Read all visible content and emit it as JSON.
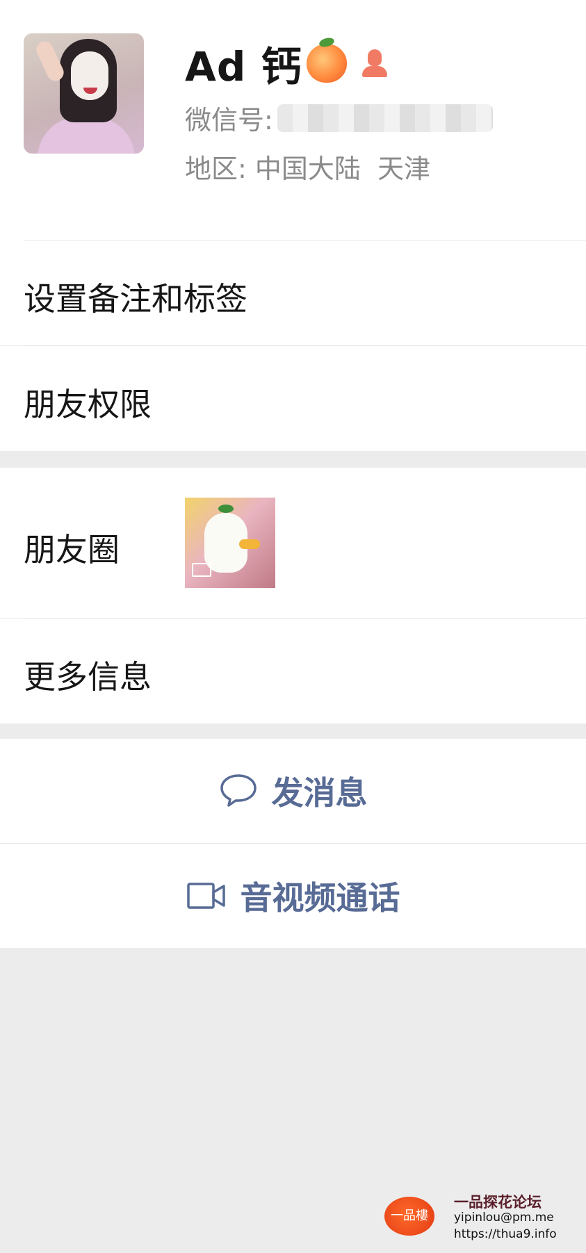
{
  "profile": {
    "name": "Ad 钙",
    "name_emoji_icon": "peach-emoji",
    "gender_icon": "female-icon",
    "wechat_id_label": "微信号:",
    "region_label": "地区:",
    "region_value": "中国大陆  天津"
  },
  "menu": {
    "remark_tags": "设置备注和标签",
    "friend_permissions": "朋友权限",
    "moments": "朋友圈",
    "more_info": "更多信息"
  },
  "actions": {
    "send_message": "发消息",
    "send_message_icon": "chat-bubble-icon",
    "av_call": "音视频通话",
    "av_call_icon": "video-camera-icon"
  },
  "watermark": {
    "logo_text": "一品樓",
    "title": "一品探花论坛",
    "email": "yipinlou@pm.me",
    "url": "https://thua9.info"
  },
  "colors": {
    "accent_link": "#576b95",
    "background": "#ececec",
    "gender_female": "#f07a63"
  }
}
